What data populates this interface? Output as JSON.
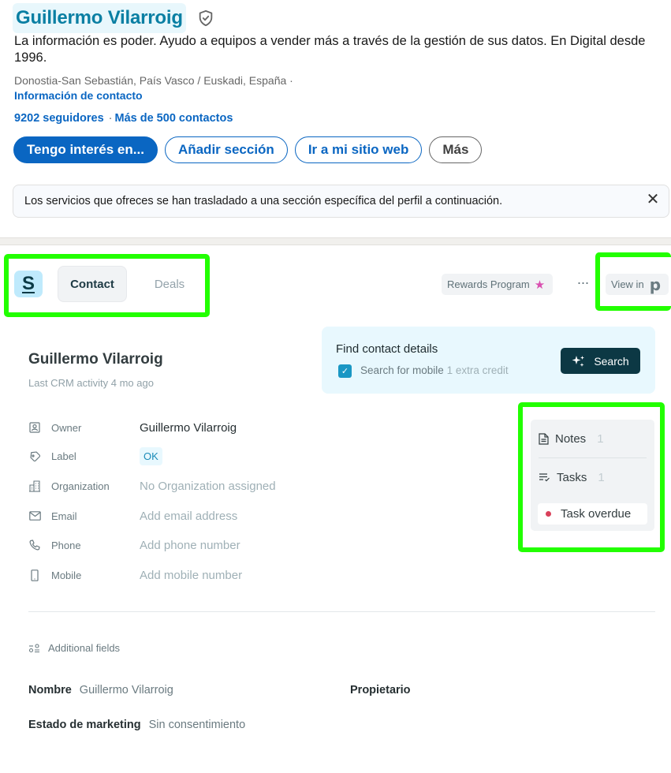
{
  "profile": {
    "name": "Guillermo Vilarroig",
    "verified_icon": "shield-check-icon",
    "headline": "La información es poder. Ayudo a equipos a vender más a través de la gestión de sus datos. En Digital desde 1996.",
    "location": "Donostia-San Sebastián, País Vasco / Euskadi, España ·",
    "contact_info_link": "Información de contacto",
    "followers": "9202 seguidores",
    "separator": "·",
    "connections": "Más de 500 contactos",
    "buttons": {
      "interested": "Tengo interés en...",
      "add_section": "Añadir sección",
      "website": "Ir a mi sitio web",
      "more": "Más"
    },
    "notice": {
      "text": "Los servicios que ofreces se han trasladado a una sección específica del perfil a continuación.",
      "close": "✕"
    }
  },
  "crm": {
    "logo_letter": "S",
    "tabs": [
      {
        "label": "Contact",
        "active": true
      },
      {
        "label": "Deals",
        "active": false
      }
    ],
    "rewards": {
      "label": "Rewards Program",
      "icon": "★"
    },
    "more_menu": "···",
    "view_in": {
      "label": "View in",
      "logo": "p"
    },
    "contact": {
      "name": "Guillermo Vilarroig",
      "last_activity": "Last CRM activity 4 mo ago"
    },
    "find_details": {
      "title": "Find contact details",
      "checkbox_checked": true,
      "checkbox_label": "Search for mobile",
      "checkbox_extra": "1 extra credit",
      "search_button": "Search"
    },
    "fields": [
      {
        "icon": "person-icon",
        "label": "Owner",
        "value": "Guillermo Vilarroig",
        "filled": true
      },
      {
        "icon": "tag-icon",
        "label": "Label",
        "value": "OK",
        "badge": true
      },
      {
        "icon": "building-icon",
        "label": "Organization",
        "value": "No Organization assigned",
        "filled": false
      },
      {
        "icon": "mail-icon",
        "label": "Email",
        "value": "Add email address",
        "filled": false
      },
      {
        "icon": "phone-icon",
        "label": "Phone",
        "value": "Add phone number",
        "filled": false
      },
      {
        "icon": "mobile-icon",
        "label": "Mobile",
        "value": "Add mobile number",
        "filled": false
      }
    ],
    "side": {
      "notes": {
        "label": "Notes",
        "count": "1"
      },
      "tasks": {
        "label": "Tasks",
        "count": "1"
      },
      "overdue": "Task overdue",
      "overdue_color": "#d9405a"
    },
    "additional_fields": {
      "title": "Additional fields",
      "items": [
        {
          "key": "Nombre",
          "value": "Guillermo Vilarroig"
        },
        {
          "key": "Propietario",
          "value": ""
        },
        {
          "key": "Estado de marketing",
          "value": "Sin consentimiento"
        }
      ]
    }
  },
  "colors": {
    "linkedin_blue": "#0a66c2",
    "name_teal": "#0a7fa3",
    "crm_dark": "#0c3844",
    "highlight_green": "#22ff00"
  }
}
